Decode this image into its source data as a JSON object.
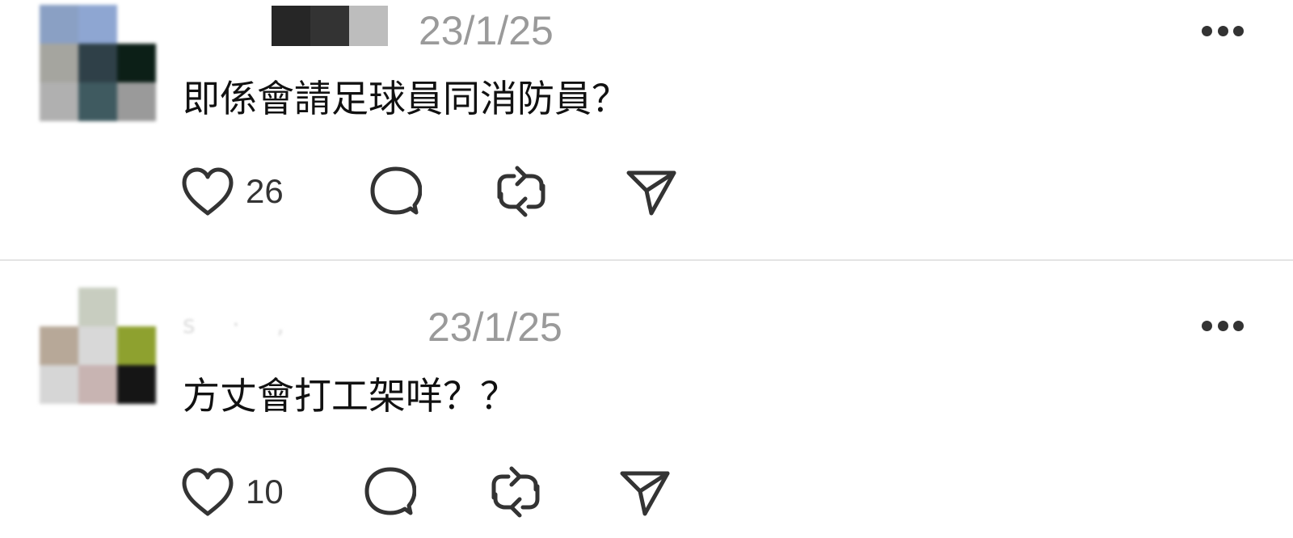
{
  "posts": [
    {
      "timestamp": "23/1/25",
      "username_fragment": "",
      "content": "即係會請足球員同消防員？",
      "like_count": "26",
      "avatar_colors": [
        "#8aa0c4",
        "#8ea6d2",
        "#ffffff",
        "#a5a59f",
        "#2f4048",
        "#0c1f17",
        "#b0b0b0",
        "#3f5a60",
        "#9a9a9a"
      ],
      "redaction_colors": [
        "#262626",
        "#333333",
        "#bdbdbd"
      ]
    },
    {
      "timestamp": "23/1/25",
      "username_fragment": "s   ·  ,",
      "content": "方丈會打工架咩？？",
      "like_count": "10",
      "avatar_colors": [
        "#ffffff",
        "#c8cdc0",
        "#ffffff",
        "#b7a898",
        "#d8d8d8",
        "#8ea12f",
        "#d6d6d6",
        "#c8b4b2",
        "#151515"
      ],
      "redaction_colors": []
    }
  ],
  "icons": {
    "like": "heart-icon",
    "reply": "comment-bubble-icon",
    "repost": "repost-icon",
    "share": "send-icon",
    "more": "more-horizontal-icon"
  },
  "colors": {
    "text": "#111111",
    "timestamp": "#9a9a9a",
    "icon": "#333333",
    "divider": "#e4e4e4"
  }
}
